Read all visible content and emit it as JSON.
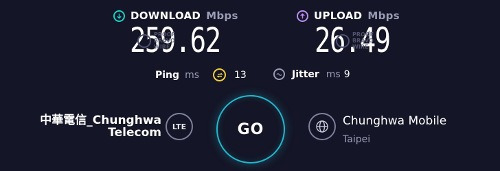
{
  "download": {
    "label": "DOWNLOAD",
    "unit": "Mbps",
    "value": "259.62",
    "icon": "download-arrow-icon",
    "accent": "#19d3c5"
  },
  "upload": {
    "label": "UPLOAD",
    "unit": "Mbps",
    "value": "26.49",
    "icon": "upload-arrow-icon",
    "accent": "#b98cf5"
  },
  "watermark": {
    "line1": "PROOF",
    "line2": "BRAVO",
    "line3": "WIRE"
  },
  "ping": {
    "label": "Ping",
    "unit": "ms",
    "value": "13",
    "accent": "#f2d03b"
  },
  "jitter": {
    "label": "Jitter",
    "unit": "ms",
    "value": "9"
  },
  "provider": {
    "line1": "中華電信_Chunghwa",
    "line2": "Telecom",
    "badge": "LTE"
  },
  "go_button": {
    "label": "GO",
    "accent": "#22b8cf"
  },
  "server": {
    "name": "Chunghwa Mobile",
    "location": "Taipei"
  },
  "colors": {
    "background": "#141526",
    "muted": "#9a9cb8"
  }
}
